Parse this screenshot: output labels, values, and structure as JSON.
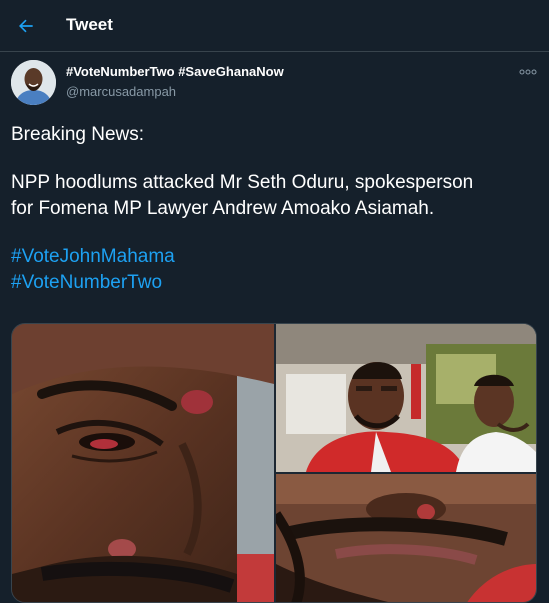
{
  "header": {
    "title": "Tweet",
    "back_icon": "arrow-left-icon"
  },
  "tweet": {
    "display_name": "#VoteNumberTwo #SaveGhanaNow",
    "handle": "@marcusadampah",
    "more_icon": "more-icon",
    "text_lines": [
      "Breaking News:",
      "NPP hoodlums attacked Mr Seth Oduru, spokesperson",
      "for Fomena MP Lawyer Andrew Amoako Asiamah."
    ],
    "hashtags": [
      "#VoteJohnMahama",
      "#VoteNumberTwo"
    ]
  },
  "colors": {
    "background": "#15202b",
    "accent": "#1da1f2",
    "secondary_text": "#8899a6",
    "border": "#38444d"
  }
}
